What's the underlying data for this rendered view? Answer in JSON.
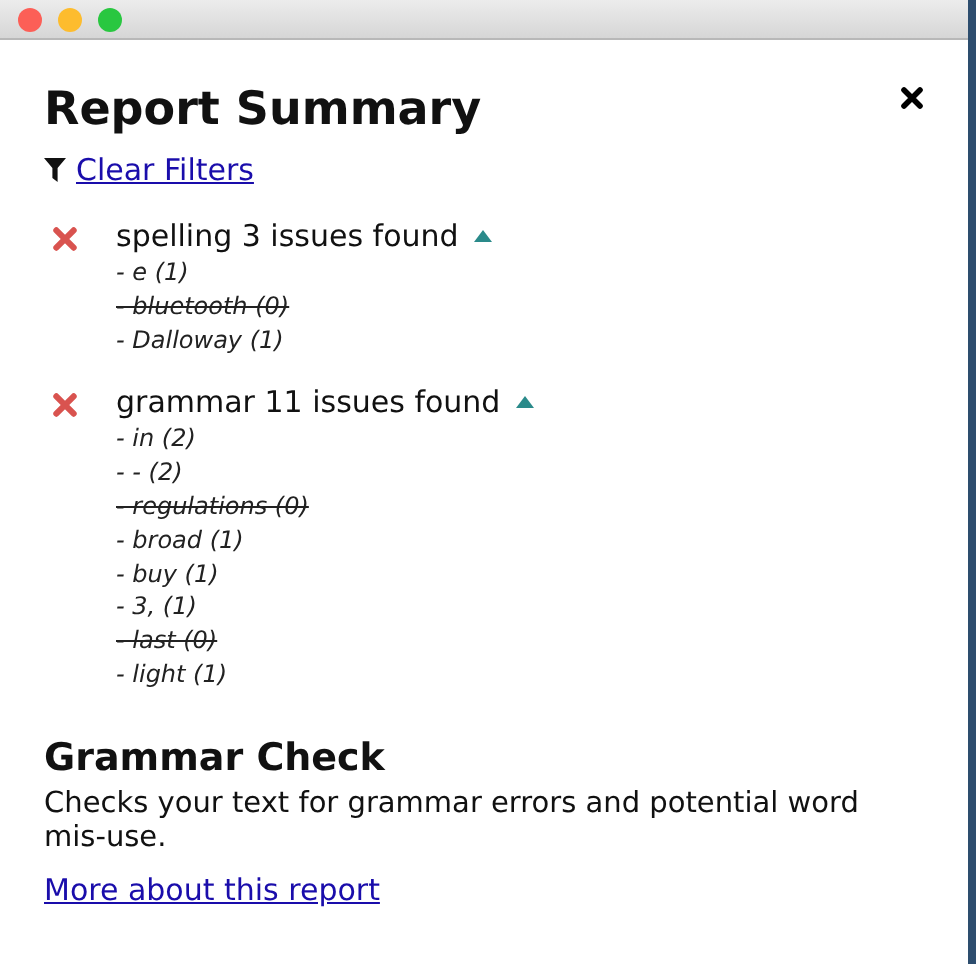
{
  "title": "Report Summary",
  "filter_link": "Clear Filters",
  "categories": [
    {
      "label": "spelling 3 issues found",
      "expanded": true,
      "items": [
        {
          "text": "- e (1)",
          "ignored": false
        },
        {
          "text": "- bluetooth (0)",
          "ignored": true
        },
        {
          "text": "- Dalloway (1)",
          "ignored": false
        }
      ]
    },
    {
      "label": "grammar 11 issues found",
      "expanded": true,
      "items": [
        {
          "text": "- in (2)",
          "ignored": false
        },
        {
          "text": "- - (2)",
          "ignored": false
        },
        {
          "text": "- regulations (0)",
          "ignored": true
        },
        {
          "text": "- broad (1)",
          "ignored": false
        },
        {
          "text": "- buy (1)",
          "ignored": false
        },
        {
          "text": "- 3, (1)",
          "ignored": false
        },
        {
          "text": "- last (0)",
          "ignored": true
        },
        {
          "text": "- light (1)",
          "ignored": false
        }
      ]
    }
  ],
  "info": {
    "heading": "Grammar Check",
    "description": "Checks your text for grammar errors and potential word mis-use.",
    "link": "More about this report"
  }
}
